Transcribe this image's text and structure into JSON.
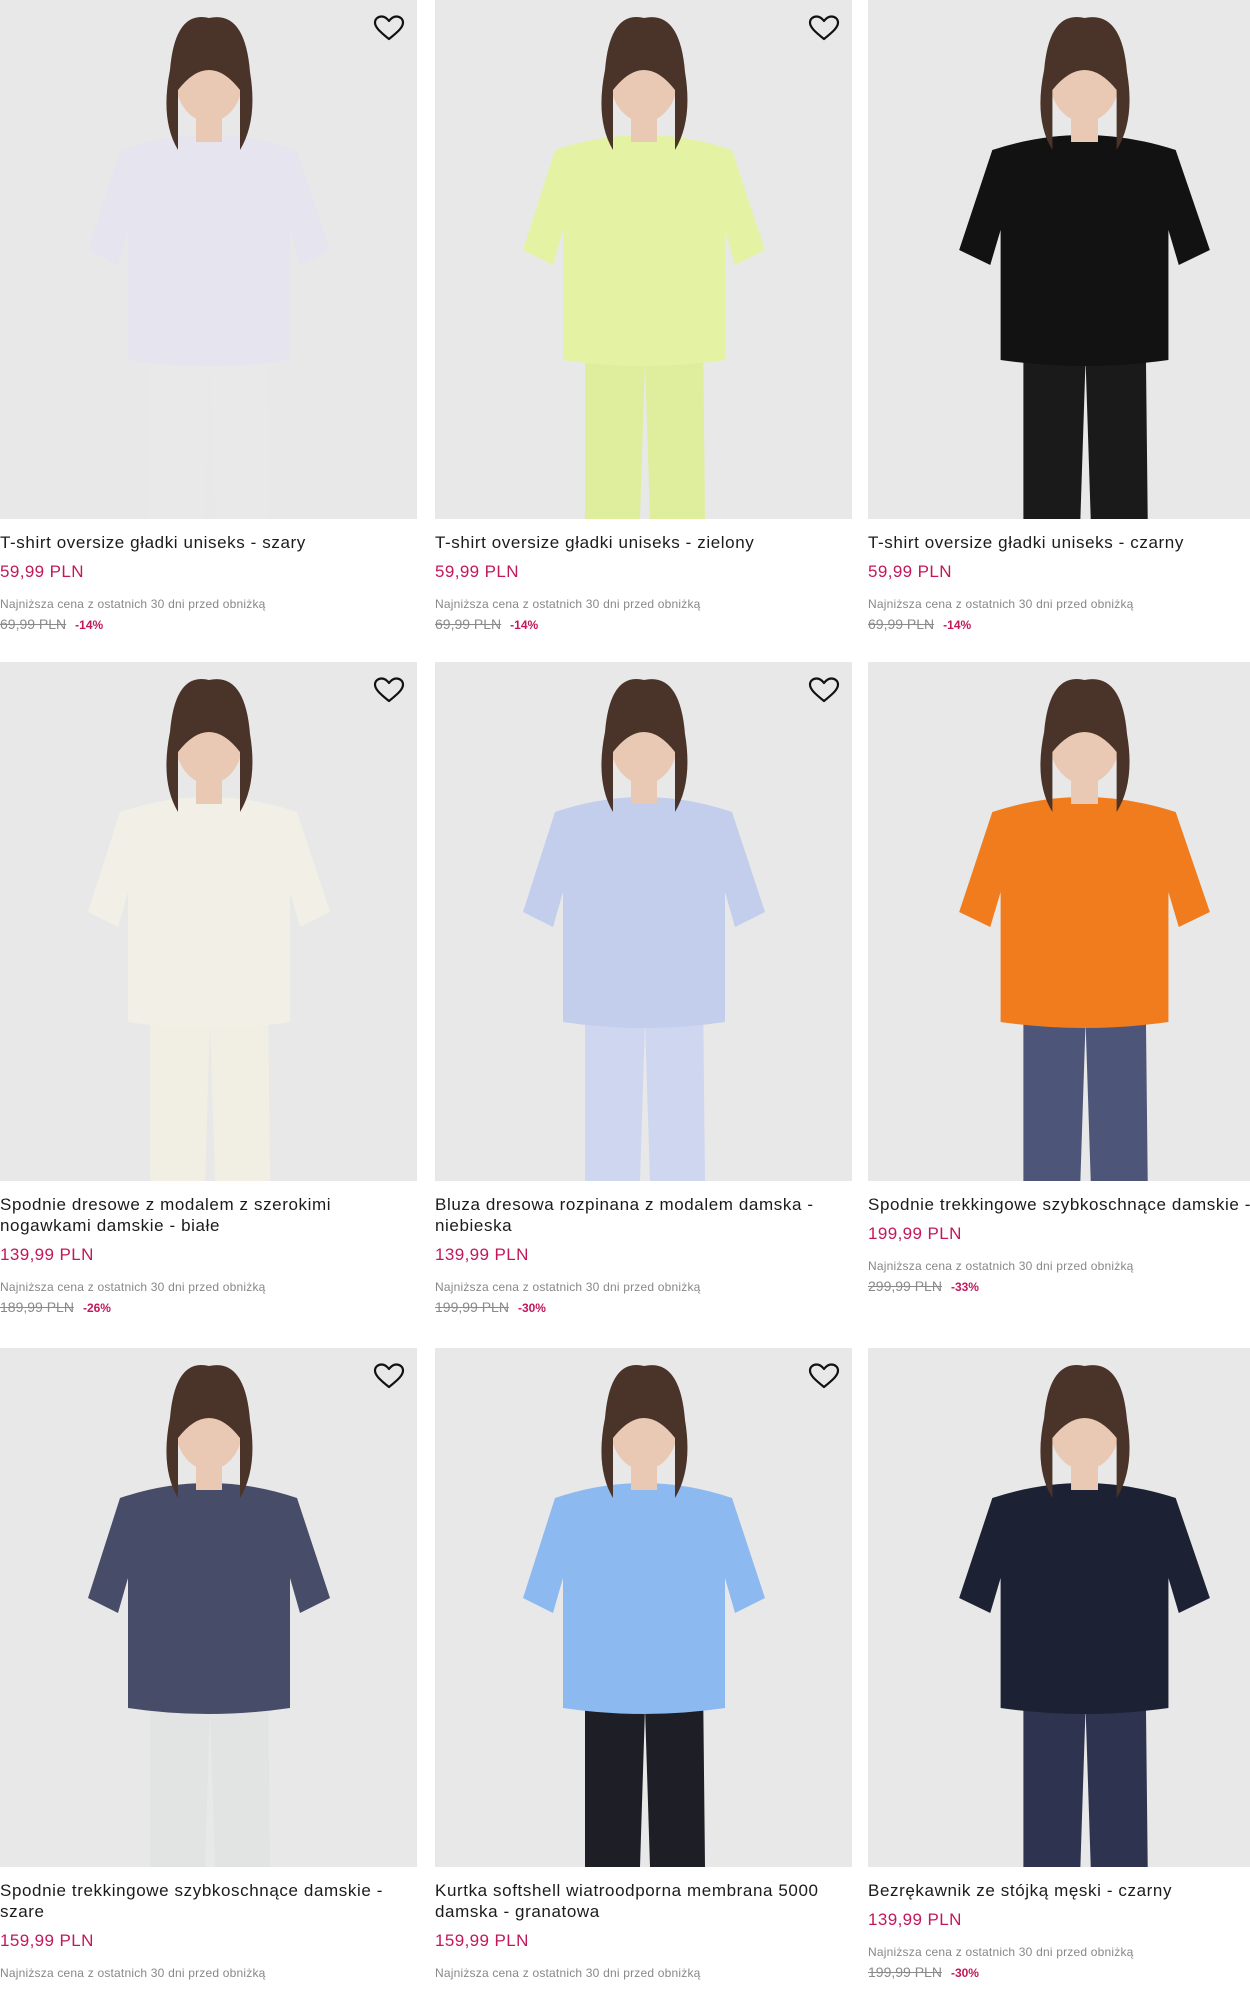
{
  "products": [
    {
      "name": "T-shirt oversize gładki uniseks - szary",
      "price": "59,99 PLN",
      "lowest_label": "Najniższa cena z ostatnich 30 dni przed obniżką",
      "old_price": "69,99 PLN",
      "discount": "-14%",
      "garment_color": "#e6e4ee",
      "bottom_color": "#e9e9ea",
      "favorite_icon": "heart-outline-icon"
    },
    {
      "name": "T-shirt oversize gładki uniseks - zielony",
      "price": "59,99 PLN",
      "lowest_label": "Najniższa cena z ostatnich 30 dni przed obniżką",
      "old_price": "69,99 PLN",
      "discount": "-14%",
      "garment_color": "#e4f2a4",
      "bottom_color": "#dfee9c",
      "favorite_icon": "heart-outline-icon"
    },
    {
      "name": "T-shirt oversize gładki uniseks - czarny",
      "price": "59,99 PLN",
      "lowest_label": "Najniższa cena z ostatnich 30 dni przed obniżką",
      "old_price": "69,99 PLN",
      "discount": "-14%",
      "garment_color": "#121212",
      "bottom_color": "#1a1a1a",
      "favorite_icon": "heart-outline-icon"
    },
    {
      "name": "Spodnie dresowe z modalem z szerokimi nogawkami damskie - białe",
      "price": "139,99 PLN",
      "lowest_label": "Najniższa cena z ostatnich 30 dni przed obniżką",
      "old_price": "189,99 PLN",
      "discount": "-26%",
      "garment_color": "#f2efe6",
      "bottom_color": "#f1eee4",
      "favorite_icon": "heart-outline-icon"
    },
    {
      "name": "Bluza dresowa rozpinana z modalem damska - niebieska",
      "price": "139,99 PLN",
      "lowest_label": "Najniższa cena z ostatnich 30 dni przed obniżką",
      "old_price": "199,99 PLN",
      "discount": "-30%",
      "garment_color": "#c3cdec",
      "bottom_color": "#cfd6ef",
      "favorite_icon": "heart-outline-icon"
    },
    {
      "name": "Spodnie trekkingowe szybkoschnące damskie - szare",
      "price": "199,99 PLN",
      "lowest_label": "Najniższa cena z ostatnich 30 dni przed obniżką",
      "old_price": "299,99 PLN",
      "discount": "-33%",
      "garment_color": "#f07c1e",
      "bottom_color": "#4d5679",
      "favorite_icon": "heart-outline-icon"
    },
    {
      "name": "Spodnie trekkingowe szybkoschnące damskie - szare",
      "price": "159,99 PLN",
      "lowest_label": "Najniższa cena z ostatnich 30 dni przed obniżką",
      "old_price": "",
      "discount": "",
      "garment_color": "#474c69",
      "bottom_color": "#e2e3e3",
      "favorite_icon": "heart-outline-icon"
    },
    {
      "name": "Kurtka softshell wiatroodporna membrana 5000 damska - granatowa",
      "price": "159,99 PLN",
      "lowest_label": "Najniższa cena z ostatnich 30 dni przed obniżką",
      "old_price": "",
      "discount": "",
      "garment_color": "#8cbaf0",
      "bottom_color": "#1d1e26",
      "favorite_icon": "heart-outline-icon"
    },
    {
      "name": "Bezrękawnik ze stójką męski - czarny",
      "price": "139,99 PLN",
      "lowest_label": "Najniższa cena z ostatnich 30 dni przed obniżką",
      "old_price": "199,99 PLN",
      "discount": "-30%",
      "garment_color": "#1c2234",
      "bottom_color": "#2e3450",
      "favorite_icon": "heart-outline-icon"
    }
  ],
  "colors": {
    "price": "#c2185b",
    "discount": "#c2185b",
    "photo_bg": "#e8e8e8"
  }
}
